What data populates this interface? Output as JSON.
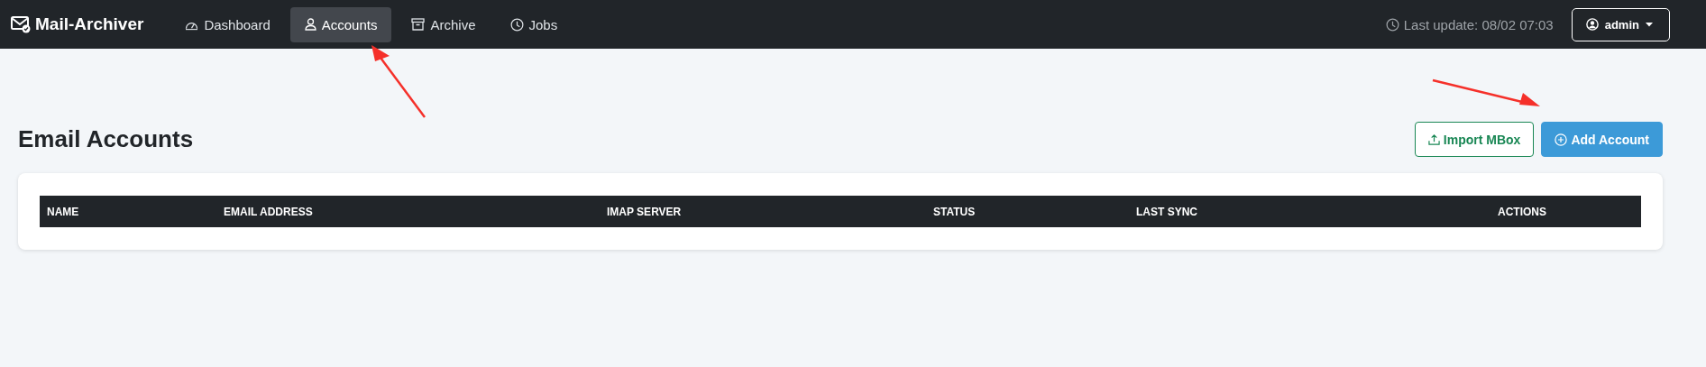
{
  "navbar": {
    "brand": "Mail-Archiver",
    "nav_items": [
      {
        "label": "Dashboard",
        "selected": false
      },
      {
        "label": "Accounts",
        "selected": true
      },
      {
        "label": "Archive",
        "selected": false
      },
      {
        "label": "Jobs",
        "selected": false
      }
    ],
    "last_update": "Last update: 08/02 07:03",
    "user": "admin"
  },
  "page": {
    "title": "Email Accounts",
    "buttons": [
      {
        "label": "Import MBox",
        "kind": "outline"
      },
      {
        "label": "Add Account",
        "kind": "primary"
      }
    ]
  },
  "table": {
    "columns": [
      "NAME",
      "EMAIL ADDRESS",
      "IMAP SERVER",
      "STATUS",
      "LAST SYNC",
      "ACTIONS"
    ]
  }
}
